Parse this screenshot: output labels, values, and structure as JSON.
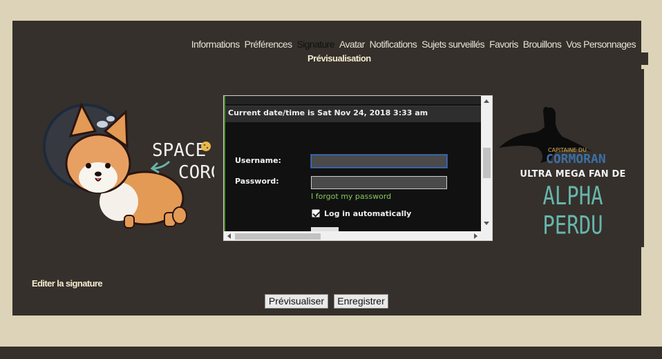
{
  "nav": {
    "items": [
      {
        "label": "Informations",
        "active": false
      },
      {
        "label": "Préférences",
        "active": false
      },
      {
        "label": "Signature",
        "active": true
      },
      {
        "label": "Avatar",
        "active": false
      },
      {
        "label": "Notifications",
        "active": false
      },
      {
        "label": "Sujets surveillés",
        "active": false
      },
      {
        "label": "Favoris",
        "active": false
      },
      {
        "label": "Brouillons",
        "active": false
      },
      {
        "label": "Vos Personnages",
        "active": false
      }
    ],
    "sub_label": "Prévisualisation"
  },
  "signature": {
    "corgi": {
      "line1": "SPACE",
      "line2": "CORGI"
    },
    "cormoran": {
      "line1": "CAPITAINE DU",
      "line2": "CORMORAN"
    },
    "fan_text": "ULTRA MEGA FAN DE",
    "alpha_text": "ALPHA PERDU",
    "accent_color": "#67b5ad"
  },
  "embedded_login": {
    "datetime": "Current date/time is Sat Nov 24, 2018 3:33 am",
    "username_label": "Username:",
    "username_value": "",
    "password_label": "Password:",
    "password_value": "",
    "forgot_link": "I forgot my password",
    "auto_login_label": "Log in automatically",
    "auto_login_checked": true
  },
  "footer": {
    "edit_link": "Editer la signature",
    "preview_button": "Prévisualiser",
    "save_button": "Enregistrer"
  }
}
